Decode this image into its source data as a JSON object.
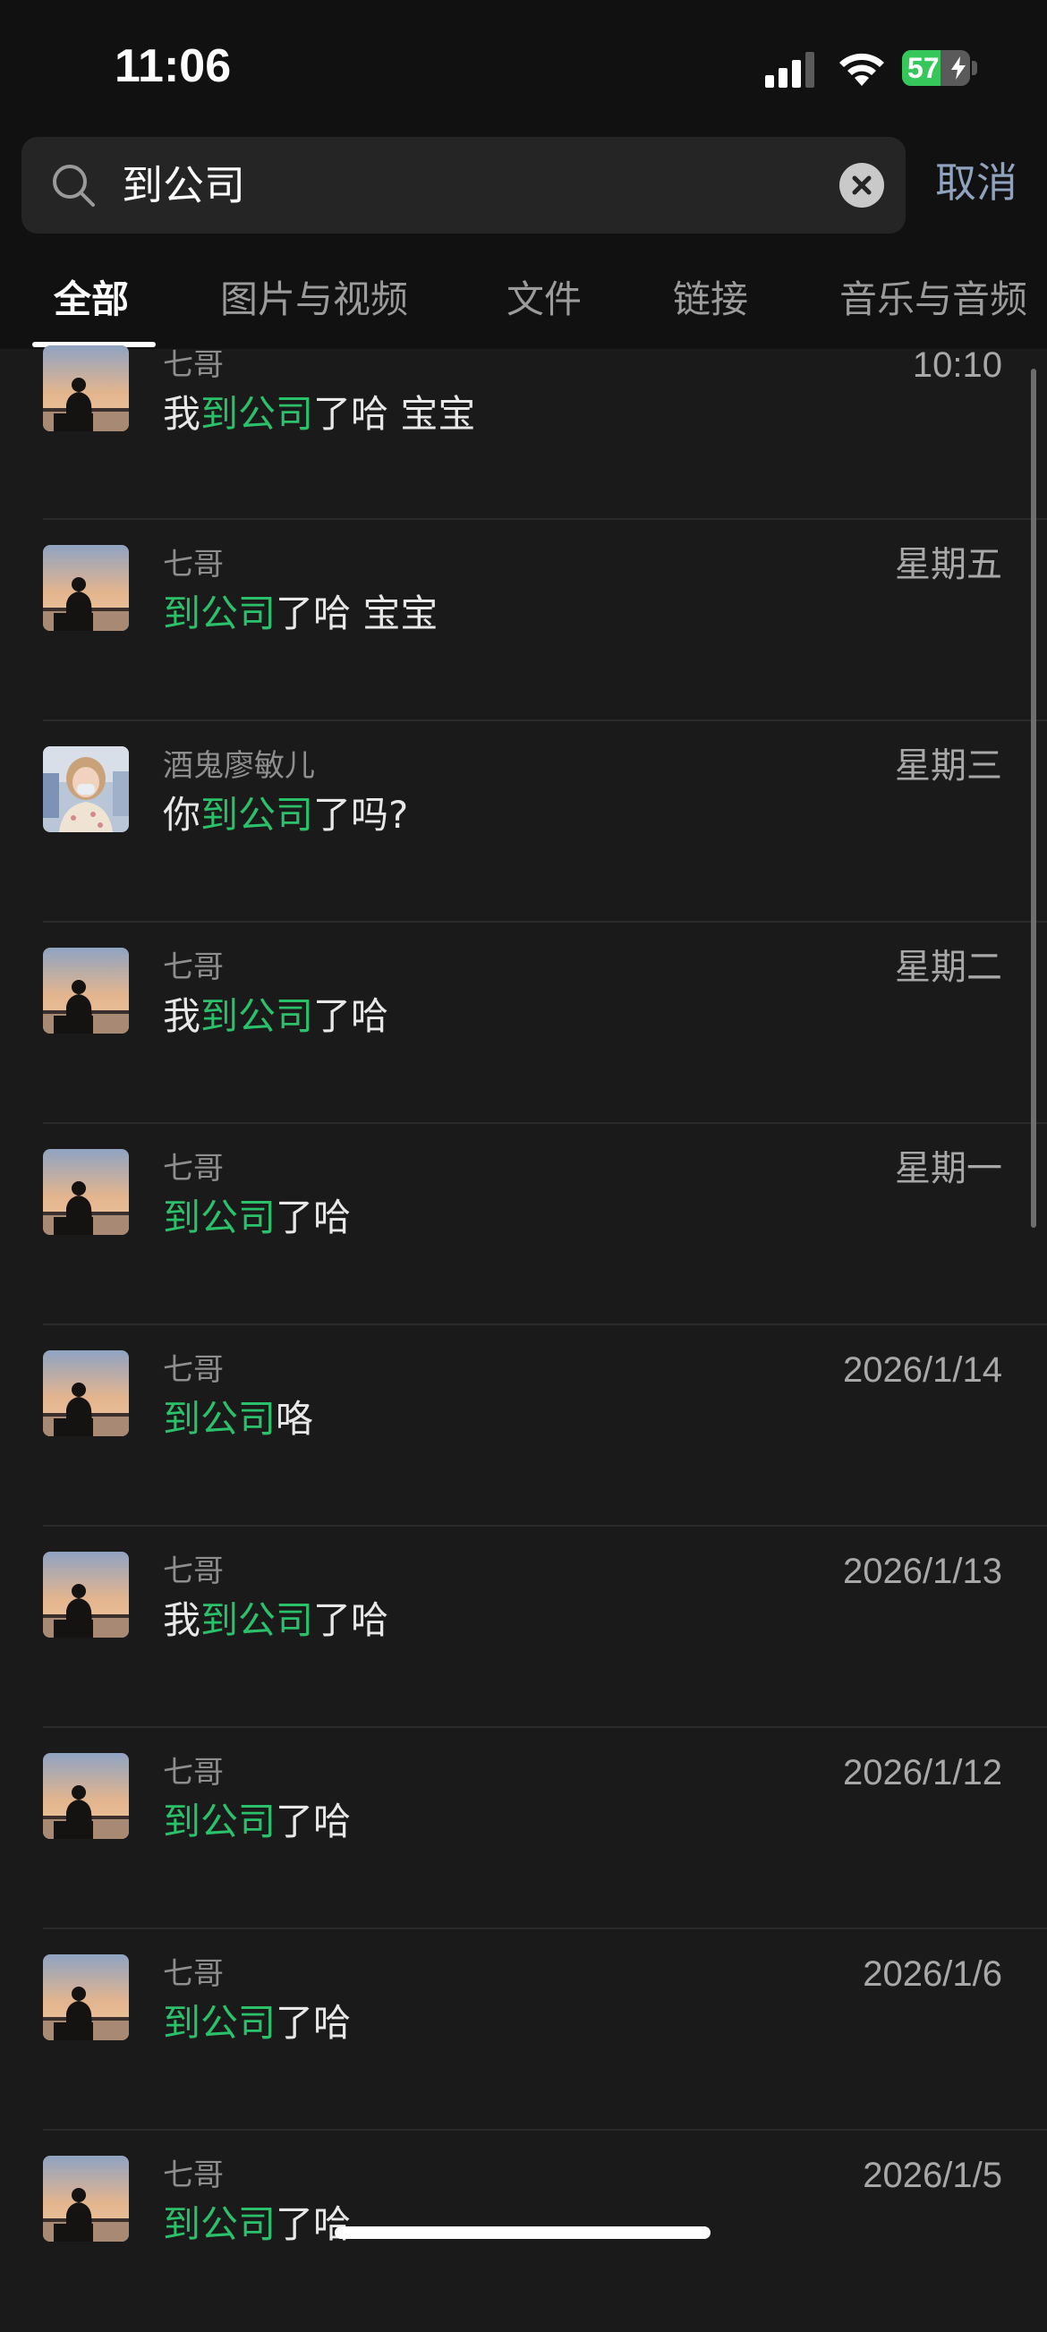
{
  "status_bar": {
    "time": "11:06",
    "battery": "57",
    "battery_level": 0.57
  },
  "search": {
    "query": "到公司",
    "cancel_label": "取消"
  },
  "tabs": [
    {
      "label": "全部",
      "active": true
    },
    {
      "label": "图片与视频",
      "active": false
    },
    {
      "label": "文件",
      "active": false
    },
    {
      "label": "链接",
      "active": false
    },
    {
      "label": "音乐与音频",
      "active": false
    }
  ],
  "results": [
    {
      "name": "七哥",
      "date": "10:10",
      "avatar": "sunset-silhouette",
      "pre": "我",
      "hl": "到公司",
      "post": "了哈 宝宝"
    },
    {
      "name": "七哥",
      "date": "星期五",
      "avatar": "sunset-silhouette",
      "pre": "",
      "hl": "到公司",
      "post": "了哈 宝宝"
    },
    {
      "name": "酒鬼廖敏儿",
      "date": "星期三",
      "avatar": "girl-photo",
      "pre": "你",
      "hl": "到公司",
      "post": "了吗?"
    },
    {
      "name": "七哥",
      "date": "星期二",
      "avatar": "sunset-silhouette",
      "pre": "我",
      "hl": "到公司",
      "post": "了哈"
    },
    {
      "name": "七哥",
      "date": "星期一",
      "avatar": "sunset-silhouette",
      "pre": "",
      "hl": "到公司",
      "post": "了哈"
    },
    {
      "name": "七哥",
      "date": "2026/1/14",
      "avatar": "sunset-silhouette",
      "pre": "",
      "hl": "到公司",
      "post": "咯"
    },
    {
      "name": "七哥",
      "date": "2026/1/13",
      "avatar": "sunset-silhouette",
      "pre": "我",
      "hl": "到公司",
      "post": "了哈"
    },
    {
      "name": "七哥",
      "date": "2026/1/12",
      "avatar": "sunset-silhouette",
      "pre": "",
      "hl": "到公司",
      "post": "了哈"
    },
    {
      "name": "七哥",
      "date": "2026/1/6",
      "avatar": "sunset-silhouette",
      "pre": "",
      "hl": "到公司",
      "post": "了哈"
    },
    {
      "name": "七哥",
      "date": "2026/1/5",
      "avatar": "sunset-silhouette",
      "pre": "",
      "hl": "到公司",
      "post": "了哈"
    }
  ],
  "colors": {
    "highlight": "#2bc16a",
    "cancel": "#8fa3bf",
    "background": "#1a1a1a"
  }
}
